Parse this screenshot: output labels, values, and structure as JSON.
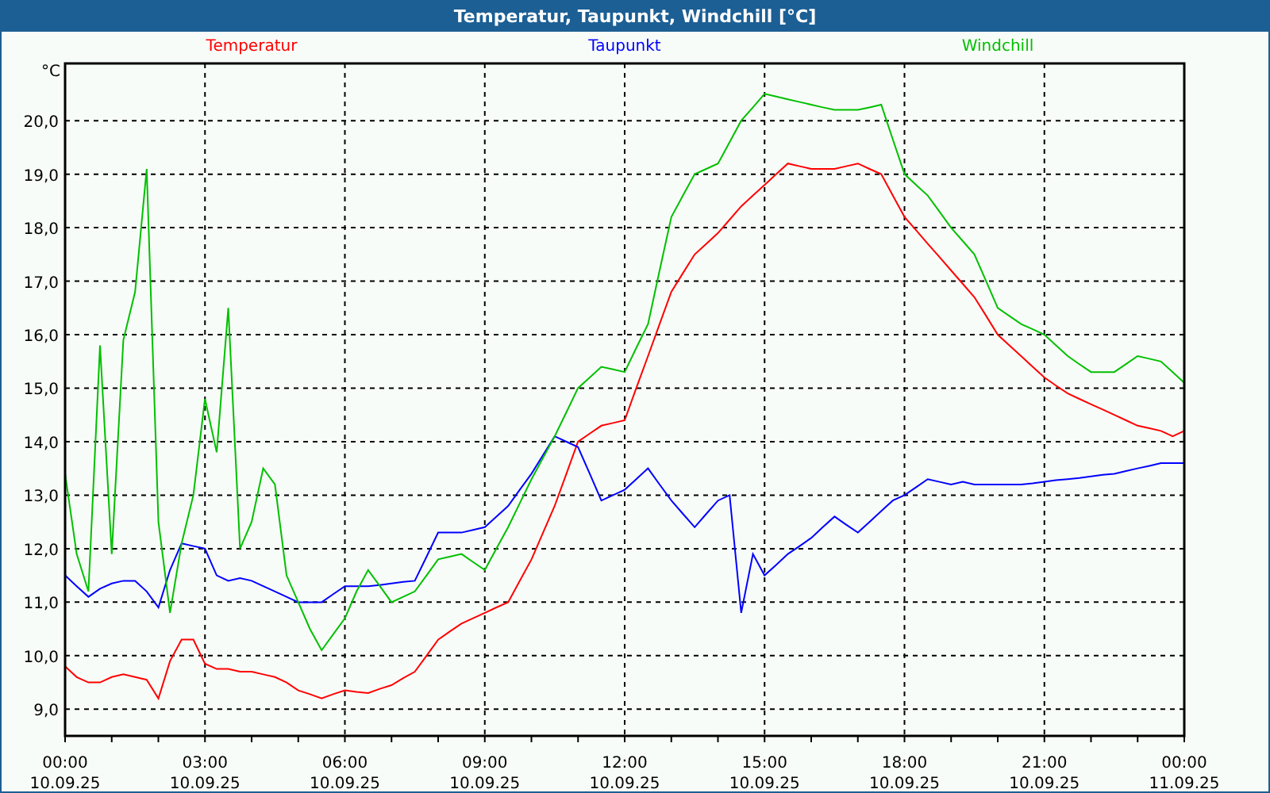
{
  "window": {
    "title": "Temperatur, Taupunkt, Windchill [°C]"
  },
  "chart": {
    "chart_data": {
      "type": "line",
      "grid": true,
      "ylabel": "°C",
      "categories": [
        "00:00 10.09.25",
        null,
        null,
        null,
        null,
        null,
        null,
        null,
        null,
        null,
        null,
        null,
        "03:00 10.09.25",
        null,
        null,
        null,
        null,
        null,
        null,
        null,
        null,
        null,
        null,
        null,
        "06:00 10.09.25",
        null,
        null,
        null,
        null,
        null,
        null,
        null,
        null,
        null,
        null,
        null,
        "09:00 10.09.25",
        null,
        null,
        null,
        null,
        null,
        null,
        null,
        null,
        null,
        null,
        null,
        "12:00 10.09.25",
        null,
        null,
        null,
        null,
        null,
        null,
        null,
        null,
        null,
        null,
        null,
        "15:00 10.09.25",
        null,
        null,
        null,
        null,
        null,
        null,
        null,
        null,
        null,
        null,
        null,
        "18:00 10.09.25",
        null,
        null,
        null,
        null,
        null,
        null,
        null,
        null,
        null,
        null,
        null,
        "21:00 10.09.25",
        null,
        null,
        null,
        null,
        null,
        null,
        null,
        null,
        null,
        null,
        null,
        "00:00 11.09.25"
      ],
      "series": [
        {
          "name": "Temperatur",
          "color": "#ff0000",
          "values": [
            9.8,
            9.6,
            9.5,
            9.5,
            9.6,
            9.65,
            9.6,
            9.55,
            9.2,
            9.9,
            10.3,
            10.3,
            9.85,
            9.75,
            9.75,
            9.7,
            9.7,
            9.65,
            9.6,
            9.5,
            9.35,
            9.28,
            9.2,
            9.28,
            9.35,
            9.32,
            9.3,
            9.38,
            9.45,
            9.58,
            9.7,
            10.0,
            10.3,
            10.45,
            10.6,
            10.7,
            10.8,
            10.9,
            11.0,
            11.4,
            11.8,
            12.3,
            12.8,
            13.4,
            14.0,
            14.15,
            14.3,
            14.35,
            14.4,
            15.0,
            15.6,
            16.2,
            16.8,
            17.15,
            17.5,
            17.7,
            17.9,
            18.15,
            18.4,
            18.6,
            18.8,
            19.0,
            19.2,
            19.15,
            19.1,
            19.1,
            19.1,
            19.15,
            19.2,
            19.1,
            19.0,
            18.6,
            18.2,
            17.95,
            17.7,
            17.45,
            17.2,
            16.95,
            16.7,
            16.35,
            16.0,
            15.8,
            15.6,
            15.4,
            15.2,
            15.05,
            14.9,
            14.8,
            14.7,
            14.6,
            14.5,
            14.4,
            14.3,
            14.25,
            14.2,
            14.1,
            14.2
          ]
        },
        {
          "name": "Taupunkt",
          "color": "#0000ff",
          "values": [
            11.5,
            11.3,
            11.1,
            11.25,
            11.35,
            11.4,
            11.4,
            11.2,
            10.9,
            11.6,
            12.1,
            12.05,
            12.0,
            11.5,
            11.4,
            11.45,
            11.4,
            11.3,
            11.2,
            11.1,
            11.0,
            11.0,
            11.0,
            11.15,
            11.3,
            11.3,
            11.3,
            11.32,
            11.35,
            11.38,
            11.4,
            11.85,
            12.3,
            12.3,
            12.3,
            12.35,
            12.4,
            12.6,
            12.8,
            13.1,
            13.4,
            13.75,
            14.1,
            14.0,
            13.9,
            13.4,
            12.9,
            13.0,
            13.1,
            13.3,
            13.5,
            13.2,
            12.9,
            12.65,
            12.4,
            12.65,
            12.9,
            13.0,
            10.8,
            11.9,
            11.5,
            11.7,
            11.9,
            12.05,
            12.2,
            12.4,
            12.6,
            12.45,
            12.3,
            12.5,
            12.7,
            12.9,
            13.0,
            13.15,
            13.3,
            13.25,
            13.2,
            13.25,
            13.2,
            13.2,
            13.2,
            13.2,
            13.2,
            13.22,
            13.25,
            13.28,
            13.3,
            13.32,
            13.35,
            13.38,
            13.4,
            13.45,
            13.5,
            13.55,
            13.6,
            13.6,
            13.6
          ]
        },
        {
          "name": "Windchill",
          "color": "#00c000",
          "values": [
            13.4,
            11.9,
            11.2,
            15.8,
            11.9,
            15.9,
            16.8,
            19.1,
            12.5,
            10.8,
            12.1,
            13.0,
            14.8,
            13.8,
            16.5,
            12.0,
            12.5,
            13.5,
            13.2,
            11.5,
            11.0,
            10.5,
            10.1,
            10.4,
            10.7,
            11.2,
            11.6,
            11.3,
            11.0,
            11.1,
            11.2,
            11.5,
            11.8,
            11.85,
            11.9,
            11.75,
            11.6,
            12.0,
            12.4,
            12.85,
            13.3,
            13.7,
            14.1,
            14.55,
            15.0,
            15.2,
            15.4,
            15.35,
            15.3,
            15.75,
            16.2,
            17.2,
            18.2,
            18.6,
            19.0,
            19.1,
            19.2,
            19.6,
            20.0,
            20.25,
            20.5,
            20.45,
            20.4,
            20.35,
            20.3,
            20.25,
            20.2,
            20.2,
            20.2,
            20.25,
            20.3,
            19.65,
            19.0,
            18.8,
            18.6,
            18.3,
            18.0,
            17.75,
            17.5,
            17.0,
            16.5,
            16.35,
            16.2,
            16.1,
            16.0,
            15.8,
            15.6,
            15.45,
            15.3,
            15.3,
            15.3,
            15.45,
            15.6,
            15.55,
            15.5,
            15.3,
            15.1
          ]
        }
      ],
      "ylim": [
        8.5,
        21.07
      ],
      "yticks": [
        {
          "value": 9,
          "label": "9,0"
        },
        {
          "value": 10,
          "label": "10,0"
        },
        {
          "value": 11,
          "label": "11,0"
        },
        {
          "value": 12,
          "label": "12,0"
        },
        {
          "value": 13,
          "label": "13,0"
        },
        {
          "value": 14,
          "label": "14,0"
        },
        {
          "value": 15,
          "label": "15,0"
        },
        {
          "value": 16,
          "label": "16,0"
        },
        {
          "value": 17,
          "label": "17,0"
        },
        {
          "value": 18,
          "label": "18,0"
        },
        {
          "value": 19,
          "label": "19,0"
        },
        {
          "value": 20,
          "label": "20,0"
        }
      ]
    }
  }
}
